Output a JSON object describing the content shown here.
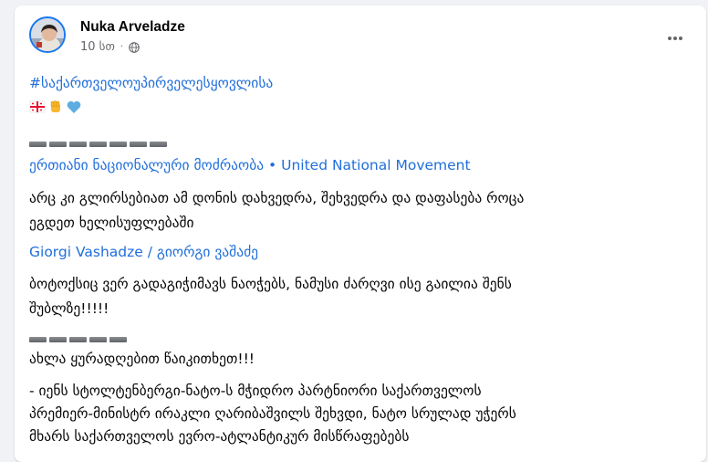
{
  "post": {
    "author": "Nuka Arveladze",
    "time": "10 სთ",
    "dot": "·",
    "hashtag": "#საქართველოუპირველესყოვლისა",
    "emojis": [
      "georgia-flag-emoji",
      "raised-fist-emoji",
      "blue-heart-emoji"
    ],
    "separator1_count": 7,
    "mention1": "ერთიანი ნაციონალური მოძრაობა • United National Movement",
    "text1_line1": " არც კი გლირსებიათ ამ დონის დახვედრა, შეხვედრა და დაფასება როცა",
    "text1_line2": "ეგდეთ ხელისუფლებაში",
    "mention2": "Giorgi Vashadze / გიორგი ვაშაძე",
    "text2_line1": " ბოტოქსიც ვერ გადაგიჭიმავს ნაოჭებს, ნამუსი ძარღვი ისე გაილია შენს",
    "text2_line2": "შუბლზე!!!!!",
    "separator2_count": 5,
    "text3": "ახლა ყურადღებით წაიკითხეთ!!!",
    "text4_line1": "- იენს სტოლტენბერგი-ნატო-ს მჭიდრო პარტნიორი საქართველოს",
    "text4_line2": "პრემიერ-მინისტრ ირაკლი ღარიბაშვილს შეხვდი, ნატო სრულად უჭერს",
    "text4_line3": "მხარს საქართველოს ევრო-ატლანტიკურ მისწრაფებებს"
  },
  "colors": {
    "link": "#216fdb",
    "text": "#050505",
    "meta": "#65676b",
    "avatar_ring": "#1877f2"
  }
}
